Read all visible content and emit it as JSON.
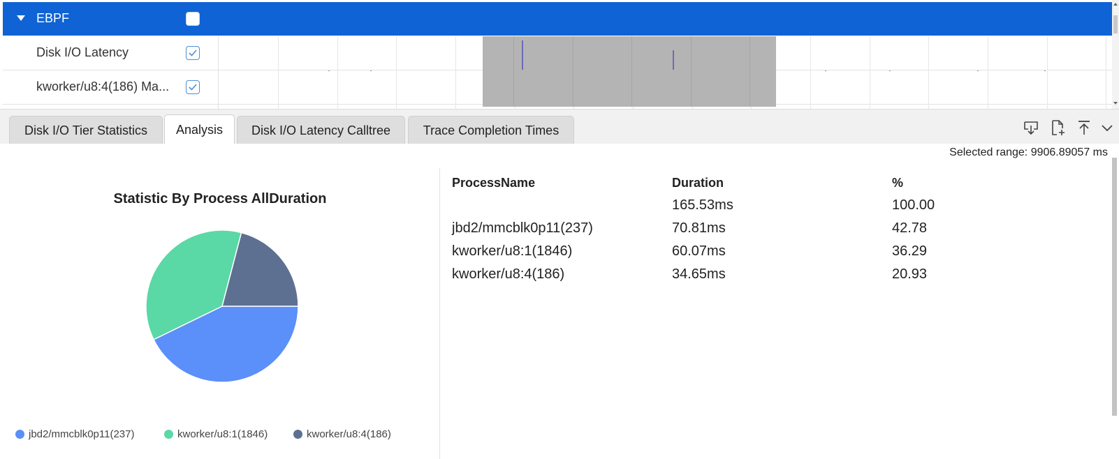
{
  "tree": {
    "group": {
      "label": "EBPF",
      "checked": false
    },
    "rows": [
      {
        "label": "Disk I/O Latency",
        "checked": true
      },
      {
        "label": "kworker/u8:4(186) Ma...",
        "checked": true
      }
    ]
  },
  "tabs": [
    {
      "label": "Disk I/O Tier Statistics",
      "active": false
    },
    {
      "label": "Analysis",
      "active": true
    },
    {
      "label": "Disk I/O Latency Calltree",
      "active": false
    },
    {
      "label": "Trace Completion Times",
      "active": false
    }
  ],
  "toolbar": {
    "icons": [
      "download-icon",
      "new-file-icon",
      "upload-icon",
      "chevron-down-icon"
    ]
  },
  "selected_range": "Selected range: 9906.89057 ms",
  "chart_data": {
    "type": "pie",
    "title": "Statistic By Process AllDuration",
    "categories": [
      "jbd2/mmcblk0p11(237)",
      "kworker/u8:1(1846)",
      "kworker/u8:4(186)"
    ],
    "values": [
      42.78,
      36.29,
      20.93
    ],
    "colors": [
      "#5b8ff9",
      "#5ad8a6",
      "#5d7092"
    ],
    "legend_position": "bottom"
  },
  "table": {
    "headers": [
      "ProcessName",
      "Duration",
      "%"
    ],
    "rows": [
      [
        "",
        "165.53ms",
        "100.00"
      ],
      [
        "jbd2/mmcblk0p11(237)",
        "70.81ms",
        "42.78"
      ],
      [
        "kworker/u8:1(1846)",
        "60.07ms",
        "36.29"
      ],
      [
        "kworker/u8:4(186)",
        "34.65ms",
        "20.93"
      ]
    ]
  },
  "colors": {
    "accent": "#0f63d4",
    "selection": "#b4b4b4"
  }
}
